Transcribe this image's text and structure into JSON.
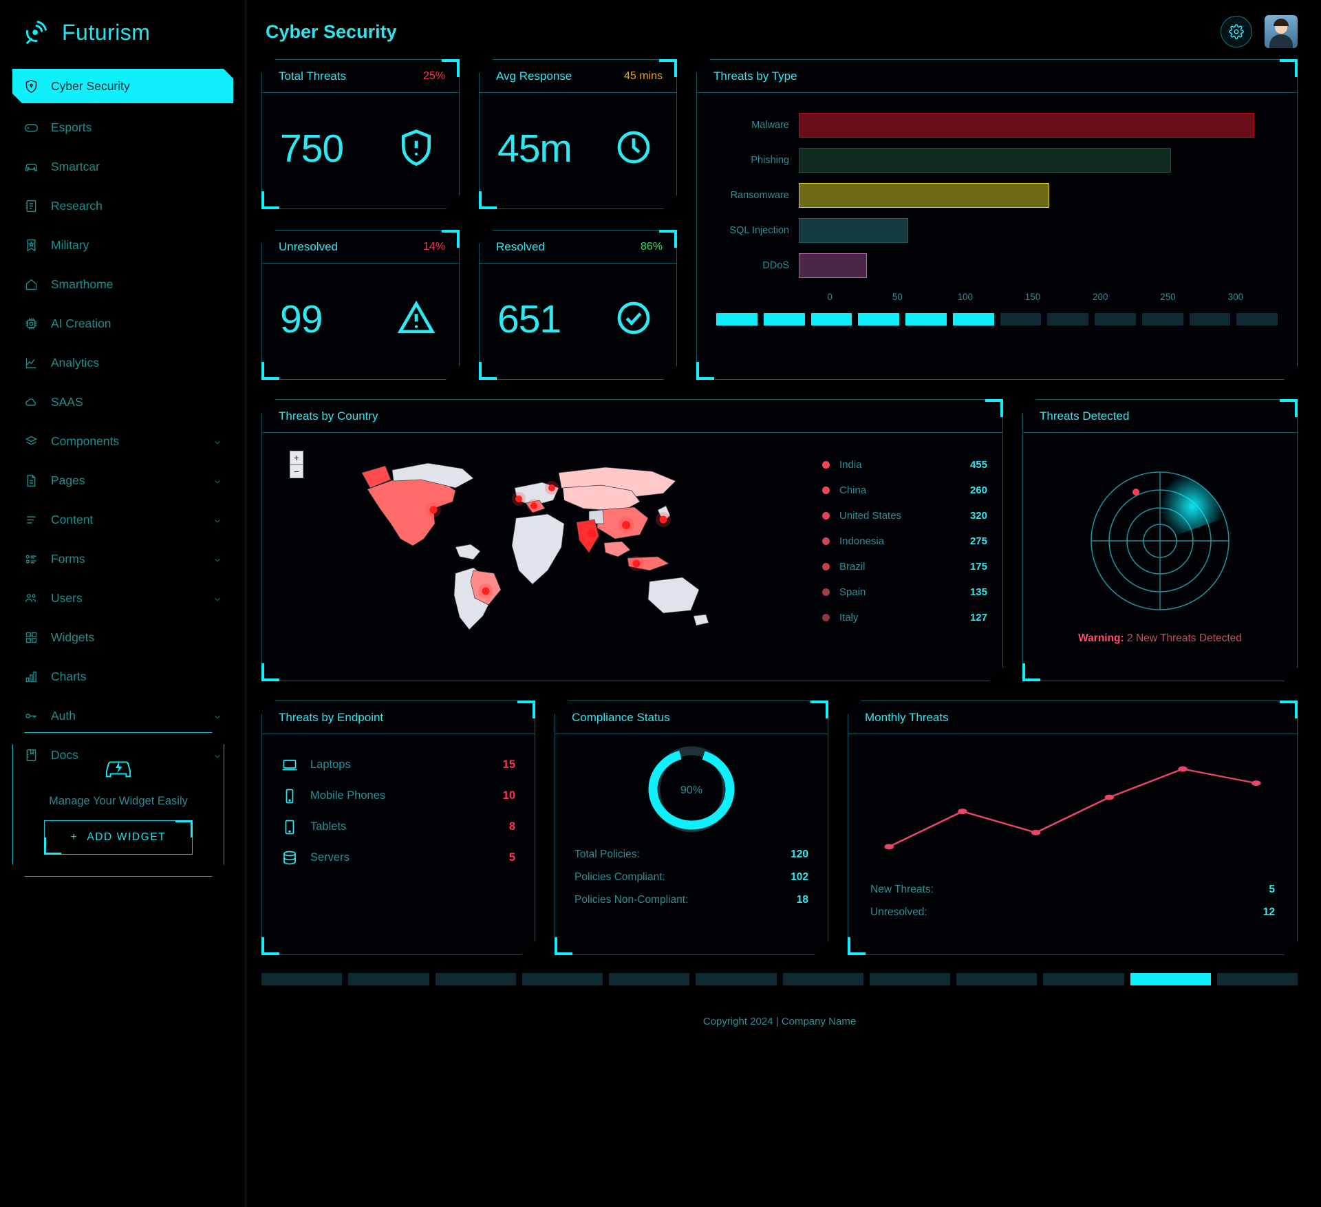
{
  "brand": {
    "name": "Futurism",
    "logo_icon": "radar-logo-icon"
  },
  "sidebar": {
    "items": [
      {
        "label": "Cyber Security",
        "icon": "shield-lock-icon",
        "active": true,
        "expandable": false
      },
      {
        "label": "Esports",
        "icon": "gamepad-icon",
        "active": false,
        "expandable": false
      },
      {
        "label": "Smartcar",
        "icon": "car-icon",
        "active": false,
        "expandable": false
      },
      {
        "label": "Research",
        "icon": "document-list-icon",
        "active": false,
        "expandable": false
      },
      {
        "label": "Military",
        "icon": "badge-star-icon",
        "active": false,
        "expandable": false
      },
      {
        "label": "Smarthome",
        "icon": "home-icon",
        "active": false,
        "expandable": false
      },
      {
        "label": "AI Creation",
        "icon": "chip-icon",
        "active": false,
        "expandable": false
      },
      {
        "label": "Analytics",
        "icon": "line-chart-icon",
        "active": false,
        "expandable": false
      },
      {
        "label": "SAAS",
        "icon": "cloud-icon",
        "active": false,
        "expandable": false
      },
      {
        "label": "Components",
        "icon": "layers-icon",
        "active": false,
        "expandable": true
      },
      {
        "label": "Pages",
        "icon": "page-icon",
        "active": false,
        "expandable": true
      },
      {
        "label": "Content",
        "icon": "align-lines-icon",
        "active": false,
        "expandable": true
      },
      {
        "label": "Forms",
        "icon": "checklist-icon",
        "active": false,
        "expandable": true
      },
      {
        "label": "Users",
        "icon": "users-icon",
        "active": false,
        "expandable": true
      },
      {
        "label": "Widgets",
        "icon": "grid-icon",
        "active": false,
        "expandable": false
      },
      {
        "label": "Charts",
        "icon": "bar-chart-icon",
        "active": false,
        "expandable": false
      },
      {
        "label": "Auth",
        "icon": "key-icon",
        "active": false,
        "expandable": true
      },
      {
        "label": "Docs",
        "icon": "book-icon",
        "active": false,
        "expandable": true
      }
    ],
    "promo": {
      "icon": "car-bolt-icon",
      "text": "Manage Your Widget Easily",
      "button_label": "ADD WIDGET",
      "button_icon": "plus-icon"
    }
  },
  "header": {
    "title": "Cyber Security",
    "gear_icon": "gear-icon",
    "avatar_icon": "user-avatar"
  },
  "kpis": [
    {
      "title": "Total Threats",
      "delta": "25%",
      "delta_color": "#ff3355",
      "value": "750",
      "icon": "shield-alert-icon"
    },
    {
      "title": "Unresolved",
      "delta": "14%",
      "delta_color": "#ff3355",
      "value": "99",
      "icon": "triangle-alert-icon"
    },
    {
      "title": "Avg Response",
      "delta": "45 mins",
      "delta_color": "#f0a020",
      "value": "45m",
      "icon": "clock-icon"
    },
    {
      "title": "Resolved",
      "delta": "86%",
      "delta_color": "#3ddc5c",
      "value": "651",
      "icon": "check-circle-icon"
    }
  ],
  "threats_by_type": {
    "title": "Threats by Type",
    "segment_total": 12,
    "segments_on": 6
  },
  "threats_by_country": {
    "title": "Threats by Country",
    "zoom_in": "+",
    "zoom_out": "−",
    "legend": [
      {
        "name": "India",
        "value": "455",
        "color": "#ff4455"
      },
      {
        "name": "China",
        "value": "260",
        "color": "#f4475a"
      },
      {
        "name": "United States",
        "value": "320",
        "color": "#e0455a"
      },
      {
        "name": "Indonesia",
        "value": "275",
        "color": "#d24455"
      },
      {
        "name": "Brazil",
        "value": "175",
        "color": "#c14352"
      },
      {
        "name": "Spain",
        "value": "135",
        "color": "#a83c4a"
      },
      {
        "name": "Italy",
        "value": "127",
        "color": "#8f3642"
      }
    ]
  },
  "threats_detected": {
    "title": "Threats Detected",
    "warning_label": "Warning:",
    "warning_text": "2 New Threats Detected"
  },
  "threats_by_endpoint": {
    "title": "Threats by Endpoint",
    "rows": [
      {
        "name": "Laptops",
        "value": "15",
        "icon": "laptop-icon"
      },
      {
        "name": "Mobile Phones",
        "value": "10",
        "icon": "mobile-icon"
      },
      {
        "name": "Tablets",
        "value": "8",
        "icon": "tablet-icon"
      },
      {
        "name": "Servers",
        "value": "5",
        "icon": "server-icon"
      }
    ]
  },
  "compliance_status": {
    "title": "Compliance Status",
    "percent_label": "90%",
    "rows": [
      {
        "key": "Total Policies:",
        "value": "120"
      },
      {
        "key": "Policies Compliant:",
        "value": "102"
      },
      {
        "key": "Policies Non-Compliant:",
        "value": "18"
      }
    ]
  },
  "monthly_threats": {
    "title": "Monthly Threats",
    "rows": [
      {
        "key": "New Threats:",
        "value": "5"
      },
      {
        "key": "Unresolved:",
        "value": "12"
      }
    ]
  },
  "pager": {
    "count": 12,
    "active_index": 10
  },
  "footer": {
    "text": "Copyright 2024 | Company Name"
  },
  "chart_data": [
    {
      "type": "bar",
      "title": "Threats by Type",
      "orientation": "horizontal",
      "categories": [
        "Malware",
        "Phishing",
        "Ransomware",
        "SQL Injection",
        "DDoS"
      ],
      "values": [
        300,
        245,
        165,
        72,
        45
      ],
      "colors": [
        "#b01020",
        "#1f4a33",
        "#d8cf2a",
        "#1d5b5e",
        "#b05fa8"
      ],
      "fill_colors": [
        "#6b0d18",
        "#112b20",
        "#6e6a18",
        "#123c3f",
        "#4c2647"
      ],
      "xlabel": "",
      "ylabel": "",
      "xticks": [
        0,
        50,
        100,
        150,
        200,
        250,
        300
      ],
      "xlim": [
        0,
        310
      ],
      "grid": false,
      "legend": "none"
    },
    {
      "type": "bar",
      "title": "Threats by Country",
      "orientation": "horizontal",
      "categories": [
        "India",
        "China",
        "United States",
        "Indonesia",
        "Brazil",
        "Spain",
        "Italy"
      ],
      "values": [
        455,
        260,
        320,
        275,
        175,
        135,
        127
      ],
      "ylabel": "Threats",
      "legend": "right"
    },
    {
      "type": "pie",
      "title": "Compliance Status",
      "labels": [
        "Compliant",
        "Non-Compliant"
      ],
      "values": [
        90,
        10
      ],
      "colors": [
        "#0ff0fc",
        "#1c3138"
      ],
      "center_label": "90%"
    },
    {
      "type": "line",
      "title": "Monthly Threats",
      "x": [
        1,
        2,
        3,
        4,
        5,
        6
      ],
      "y": [
        2,
        7,
        4,
        9,
        13,
        11
      ],
      "ylim": [
        0,
        15
      ],
      "color": "#e8456b",
      "markers": true,
      "grid": false,
      "legend": "none"
    },
    {
      "type": "bar",
      "title": "Threats by Endpoint",
      "categories": [
        "Laptops",
        "Mobile Phones",
        "Tablets",
        "Servers"
      ],
      "values": [
        15,
        10,
        8,
        5
      ],
      "color": "#ff3355",
      "legend": "none"
    }
  ]
}
